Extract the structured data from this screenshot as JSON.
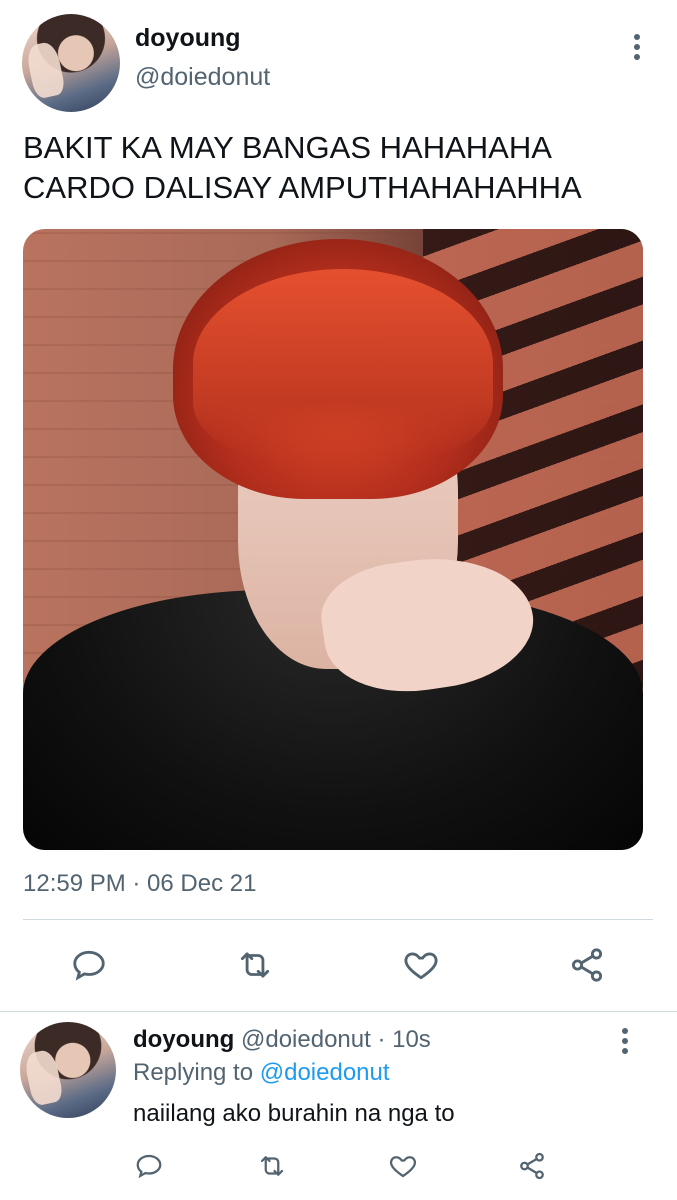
{
  "main_tweet": {
    "display_name": "doyoung",
    "handle": "@doiedonut",
    "text_line1": "BAKIT KA MAY BANGAS HAHAHAHA",
    "text_line2": "CARDO DALISAY AMPUTHAHAHAHHA",
    "timestamp": "12:59 PM · 06 Dec 21"
  },
  "reply": {
    "display_name": "doyoung",
    "handle": "@doiedonut",
    "time": "· 10s",
    "replying_prefix": "Replying to",
    "replying_handle": "@doiedonut",
    "text": "naiilang ako burahin na nga to"
  },
  "icons": {
    "reply": "reply-icon",
    "retweet": "retweet-icon",
    "like": "heart-icon",
    "share": "share-icon",
    "more": "more-vertical-icon"
  },
  "colors": {
    "text": "#0f1419",
    "muted": "#536471",
    "link": "#1d9bf0",
    "divider": "#cfd9de"
  }
}
